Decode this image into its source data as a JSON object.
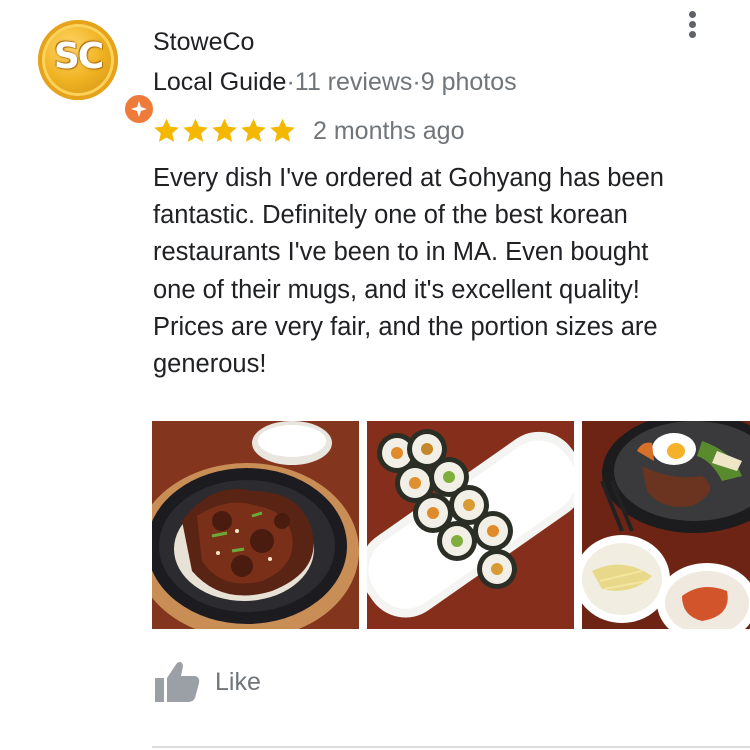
{
  "reviewer": {
    "initials": "SC",
    "name": "StoweCo",
    "level": "Local Guide",
    "separator": "·",
    "reviews_count": "11 reviews",
    "photos_count": "9 photos"
  },
  "rating": {
    "stars": 5,
    "max_stars": 5,
    "date": "2 months ago"
  },
  "review": {
    "lines": [
      "Every dish I've ordered at Gohyang has been",
      "fantastic. Definitely one of the best korean",
      "restaurants I've been to in MA. Even bought",
      "one of their mugs, and it's excellent quality!",
      "Prices are very fair, and the portion sizes are",
      "generous!"
    ]
  },
  "photos": [
    {
      "icon": "galbi-photo"
    },
    {
      "icon": "kimbap-photo"
    },
    {
      "icon": "bibimbap-photo"
    }
  ],
  "actions": {
    "like_label": "Like"
  },
  "colors": {
    "star": "#f5b800",
    "text": "#202124",
    "muted": "#70757a",
    "badge": "#ef7b3a",
    "coin": "#f0b323"
  }
}
